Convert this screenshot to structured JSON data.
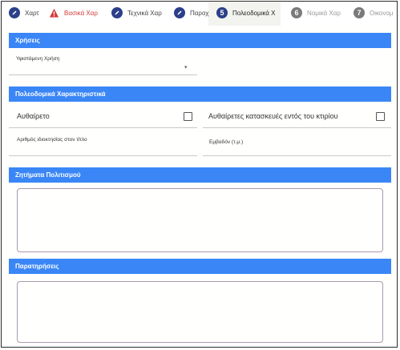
{
  "stepper": {
    "steps": [
      {
        "label": "Χαρτ",
        "state": "done",
        "icon": "pencil-icon"
      },
      {
        "label": "Βασικά Χαρ",
        "state": "error",
        "icon": "warning-icon"
      },
      {
        "label": "Τεχνικά Χαρ",
        "state": "done",
        "icon": "pencil-icon"
      },
      {
        "label": "Παροχ",
        "state": "done",
        "icon": "pencil-icon"
      },
      {
        "label": "Πολεοδομικά Χ",
        "state": "current",
        "number": "5"
      },
      {
        "label": "Νομικά Χαρ",
        "state": "todo",
        "number": "6"
      },
      {
        "label": "Οικονομ",
        "state": "todo",
        "number": "7"
      }
    ]
  },
  "uses": {
    "title": "Χρήσεις",
    "existing_use_label": "Υφιστάμενη Χρήση",
    "existing_use_value": ""
  },
  "urban": {
    "title": "Πολεοδομικά Χαρακτηριστικά",
    "unauthorized_label": "Αυθαίρετο",
    "unauthorized_checked": false,
    "unauthorized_inside_label": "Αυθαίρετες κατασκευές εντός του κτιρίου",
    "unauthorized_inside_checked": false,
    "ownership_number_label": "Αριθμός ιδιοκτησίας στον τίτλο",
    "ownership_number_value": "",
    "area_label": "Εμβαδόν (τ.μ.)",
    "area_value": ""
  },
  "culture": {
    "title": "Ζητήματα Πολιτισμού",
    "value": ""
  },
  "remarks": {
    "title": "Παρατηρήσεις",
    "value": ""
  },
  "colors": {
    "header": "#3a86f6",
    "step_done": "#2c3f8a",
    "step_error": "#d33a3a",
    "step_todo": "#7a7a7a"
  }
}
